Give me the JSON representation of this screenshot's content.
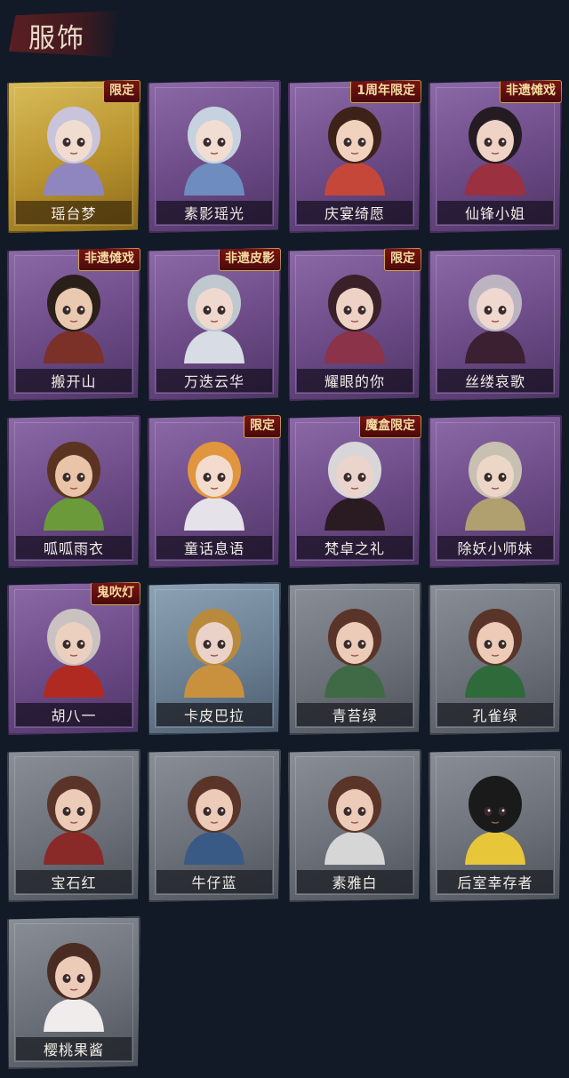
{
  "header": {
    "title": "服饰"
  },
  "colors": {
    "background": "#131a27",
    "purple_tier": "#7b5a98",
    "gold_tier": "#c9a640",
    "gray_tier": "#70757e",
    "tag_red": "#7a1412",
    "tag_border": "#d4a54a"
  },
  "outfits": [
    {
      "name": "瑶台梦",
      "tier": "gold",
      "tag": "限定",
      "hair": "#c9c3dc",
      "skin": "#f1dcd0",
      "cloth": "#8f86c0"
    },
    {
      "name": "素影瑶光",
      "tier": "purple",
      "tag": "",
      "hair": "#c7d2e0",
      "skin": "#f1ddd2",
      "cloth": "#6e8cbf"
    },
    {
      "name": "庆宴绮愿",
      "tier": "purple",
      "tag": "1周年限定",
      "hair": "#3c2218",
      "skin": "#f0d2bf",
      "cloth": "#c4473a"
    },
    {
      "name": "仙锋小姐",
      "tier": "purple",
      "tag": "非遗傩戏",
      "hair": "#241c22",
      "skin": "#efd3c6",
      "cloth": "#9a3040"
    },
    {
      "name": "搬开山",
      "tier": "purple",
      "tag": "非遗傩戏",
      "hair": "#2b1f1a",
      "skin": "#e9c9b0",
      "cloth": "#7b3028"
    },
    {
      "name": "万迭云华",
      "tier": "purple",
      "tag": "非遗皮影",
      "hair": "#bfc7cf",
      "skin": "#efd9cf",
      "cloth": "#d8dce4"
    },
    {
      "name": "耀眼的你",
      "tier": "purple",
      "tag": "限定",
      "hair": "#3a2028",
      "skin": "#efd2c6",
      "cloth": "#8b3348"
    },
    {
      "name": "丝缕哀歌",
      "tier": "purple",
      "tag": "",
      "hair": "#bdb4c2",
      "skin": "#efd8d0",
      "cloth": "#3a2030"
    },
    {
      "name": "呱呱雨衣",
      "tier": "purple",
      "tag": "",
      "hair": "#5a3420",
      "skin": "#e9c4a8",
      "cloth": "#6b9a3a"
    },
    {
      "name": "童话息语",
      "tier": "purple",
      "tag": "限定",
      "hair": "#e0953e",
      "skin": "#f3dccd",
      "cloth": "#e6e2ea"
    },
    {
      "name": "梵卓之礼",
      "tier": "purple",
      "tag": "魔盒限定",
      "hair": "#d8d6d8",
      "skin": "#ead4cc",
      "cloth": "#2a1a22"
    },
    {
      "name": "除妖小师妹",
      "tier": "purple",
      "tag": "",
      "hair": "#c8c0b0",
      "skin": "#ecd6c8",
      "cloth": "#b0a070"
    },
    {
      "name": "胡八一",
      "tier": "purple",
      "tag": "鬼吹灯",
      "hair": "#c9c2c0",
      "skin": "#ecd0bf",
      "cloth": "#b02a22"
    },
    {
      "name": "卡皮巴拉",
      "tier": "bluegray",
      "tag": "",
      "hair": "#b98a3c",
      "skin": "#ead2c8",
      "cloth": "#c9913e"
    },
    {
      "name": "青苔绿",
      "tier": "gray",
      "tag": "",
      "hair": "#5a3428",
      "skin": "#eccbb8",
      "cloth": "#3f6a45"
    },
    {
      "name": "孔雀绿",
      "tier": "gray",
      "tag": "",
      "hair": "#5a3428",
      "skin": "#eccbb8",
      "cloth": "#2f6a3a"
    },
    {
      "name": "宝石红",
      "tier": "gray",
      "tag": "",
      "hair": "#5a3428",
      "skin": "#eccbb8",
      "cloth": "#8a2a28"
    },
    {
      "name": "牛仔蓝",
      "tier": "gray",
      "tag": "",
      "hair": "#5a3428",
      "skin": "#eccbb8",
      "cloth": "#3a5a86"
    },
    {
      "name": "素雅白",
      "tier": "gray",
      "tag": "",
      "hair": "#5a3428",
      "skin": "#eccbb8",
      "cloth": "#d6d6d6"
    },
    {
      "name": "后室幸存者",
      "tier": "gray",
      "tag": "",
      "hair": "#1a1a1a",
      "skin": "#1a1a1a",
      "cloth": "#e8c63a"
    },
    {
      "name": "樱桃果酱",
      "tier": "gray",
      "tag": "",
      "hair": "#4a2c22",
      "skin": "#eccbb8",
      "cloth": "#f0ecec"
    }
  ]
}
